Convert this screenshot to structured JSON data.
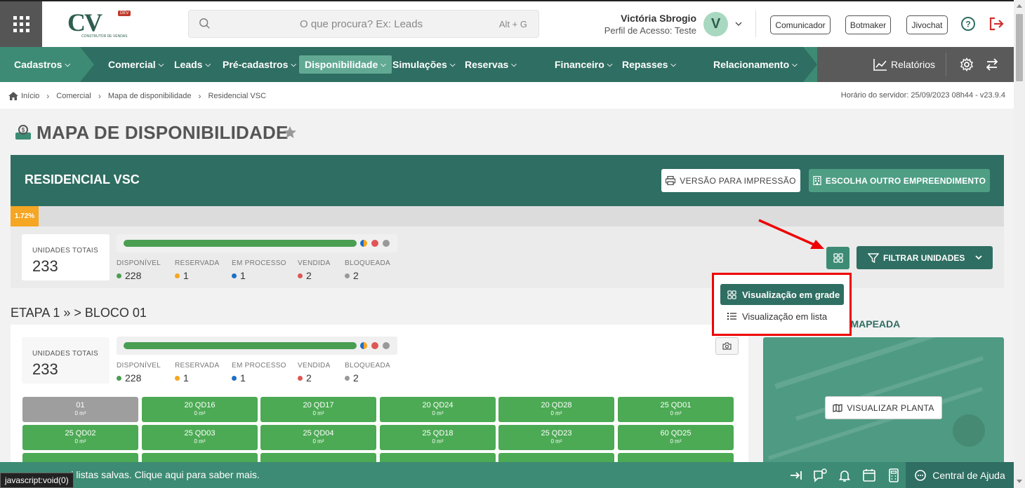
{
  "header": {
    "logo_text": "CV",
    "logo_sub": "CONSTRUTOR DE VENDAS",
    "logo_badge": "DEV",
    "search_placeholder": "O que procura? Ex: Leads",
    "search_shortcut": "Alt + G",
    "user_name": "Victória Sbrogio",
    "user_profile": "Perfil de Acesso: Teste",
    "avatar_letter": "V",
    "buttons": [
      "Comunicador",
      "Botmaker",
      "Jivochat"
    ]
  },
  "nav": {
    "items": [
      "Cadastros",
      "Comercial",
      "Leads",
      "Pré-cadastros",
      "Disponibilidade",
      "Simulações",
      "Reservas",
      "Financeiro",
      "Repasses",
      "Relacionamento"
    ],
    "active": "Disponibilidade",
    "reports": "Relatórios"
  },
  "breadcrumb": {
    "items": [
      "Início",
      "Comercial",
      "Mapa de disponibilidade",
      "Residencial VSC"
    ],
    "server_time": "Horário do servidor: 25/09/2023 08h44 - v23.9.4"
  },
  "page": {
    "title": "MAPA DE DISPONIBILIDADE"
  },
  "card": {
    "title": "RESIDENCIAL VSC",
    "print_button": "VERSÃO PARA IMPRESSÃO",
    "other_button": "ESCOLHA OUTRO EMPREENDIMENTO",
    "progress_label": "1.72%",
    "progress_value": 1.72,
    "filter_button": "FILTRAR UNIDADES"
  },
  "stats": {
    "total_label": "UNIDADES TOTAIS",
    "total_value": "233",
    "legend": [
      {
        "label": "DISPONÍVEL",
        "value": "228",
        "color": "#4a9e52"
      },
      {
        "label": "RESERVADA",
        "value": "1",
        "color": "#f5a623"
      },
      {
        "label": "EM PROCESSO",
        "value": "1",
        "color": "#1f6fc5"
      },
      {
        "label": "VENDIDA",
        "value": "2",
        "color": "#e05555"
      },
      {
        "label": "BLOQUEADA",
        "value": "2",
        "color": "#999999"
      }
    ]
  },
  "view_menu": {
    "grid": "Visualização em grade",
    "list": "Visualização em lista"
  },
  "etapa": {
    "title": "ETAPA 1 » > BLOCO 01",
    "units": [
      {
        "name": "01",
        "area": "0 m²",
        "status": "blocked"
      },
      {
        "name": "20 QD16",
        "area": "0 m²",
        "status": "available"
      },
      {
        "name": "20 QD17",
        "area": "0 m²",
        "status": "available"
      },
      {
        "name": "20 QD24",
        "area": "0 m²",
        "status": "available"
      },
      {
        "name": "20 QD28",
        "area": "0 m²",
        "status": "available"
      },
      {
        "name": "25 QD01",
        "area": "0 m²",
        "status": "available"
      },
      {
        "name": "25 QD02",
        "area": "0 m²",
        "status": "available"
      },
      {
        "name": "25 QD03",
        "area": "0 m²",
        "status": "available"
      },
      {
        "name": "25 QD04",
        "area": "0 m²",
        "status": "available"
      },
      {
        "name": "25 QD18",
        "area": "0 m²",
        "status": "available"
      },
      {
        "name": "25 QD23",
        "area": "0 m²",
        "status": "available"
      },
      {
        "name": "60 QD25",
        "area": "0 m²",
        "status": "available"
      },
      {
        "name": "",
        "area": "",
        "status": "available"
      },
      {
        "name": "",
        "area": "",
        "status": "available"
      },
      {
        "name": "",
        "area": "",
        "status": "available"
      },
      {
        "name": "",
        "area": "",
        "status": "available"
      },
      {
        "name": "",
        "area": "",
        "status": "available"
      },
      {
        "name": "",
        "area": "",
        "status": "available"
      }
    ]
  },
  "map": {
    "title": "A MAPEADA",
    "button": "VISUALIZAR PLANTA"
  },
  "bottom": {
    "message": "possui listas salvas. Clique aqui para saber mais.",
    "status_tip": "javascript:void(0)",
    "help": "Central de Ajuda"
  }
}
